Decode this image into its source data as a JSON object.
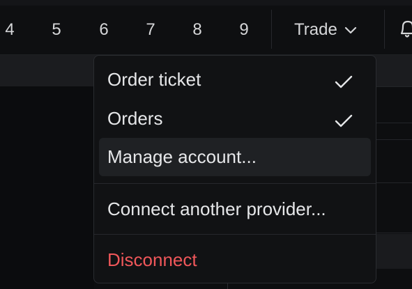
{
  "timeframes": [
    "4",
    "5",
    "6",
    "7",
    "8",
    "9"
  ],
  "toolbar": {
    "trade_label": "Trade"
  },
  "menu": {
    "items": [
      {
        "label": "Order ticket",
        "checked": true
      },
      {
        "label": "Orders",
        "checked": true
      },
      {
        "label": "Manage account...",
        "checked": false,
        "highlighted": true
      },
      {
        "label": "Connect another provider...",
        "checked": false
      },
      {
        "label": "Disconnect",
        "checked": false,
        "danger": true
      }
    ]
  },
  "colors": {
    "danger": "#f0575a",
    "text": "#e6e7e9",
    "menu_bg": "#111214",
    "highlight_bg": "#1f2124"
  }
}
